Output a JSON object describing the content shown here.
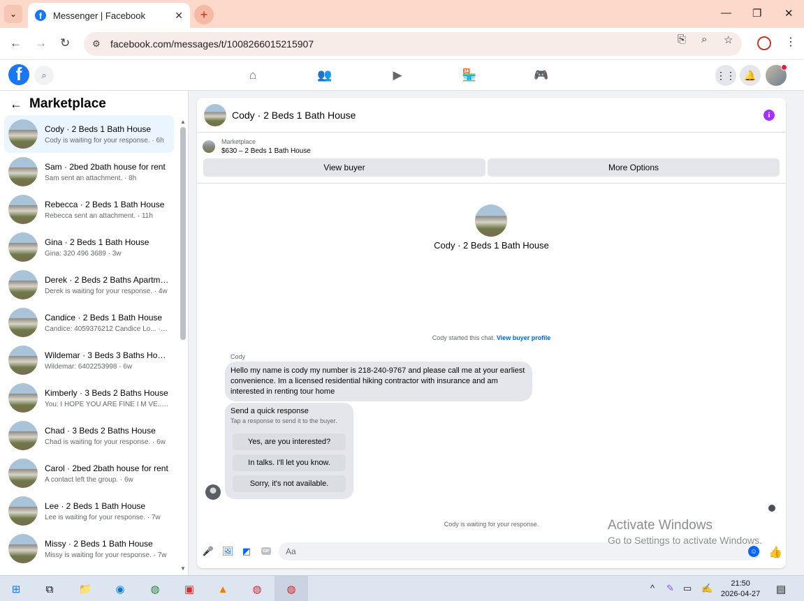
{
  "browser": {
    "tab_title": "Messenger | Facebook",
    "url": "facebook.com/messages/t/1008266015215907",
    "icons": [
      "tab-dropdown-icon",
      "facebook-favicon",
      "close-icon",
      "plus-icon",
      "minimize-icon",
      "restore-icon",
      "close-window-icon",
      "back-icon",
      "forward-icon",
      "reload-icon",
      "site-settings-icon",
      "install-app-icon",
      "zoom-icon",
      "star-icon",
      "profile-icon",
      "menu-icon"
    ]
  },
  "fb_header": {
    "logo": "f",
    "icons": [
      "search-icon",
      "home-icon",
      "friends-icon",
      "video-icon",
      "marketplace-icon",
      "gaming-icon",
      "menu-grid-icon",
      "notifications-icon",
      "account-avatar"
    ]
  },
  "sidebar": {
    "title": "Marketplace",
    "conversations": [
      {
        "name": "Cody · 2 Beds 1 Bath House",
        "sub": "Cody is waiting for your response. · 6h"
      },
      {
        "name": "Sam · 2bed 2bath house for rent",
        "sub": "Sam sent an attachment. · 8h"
      },
      {
        "name": "Rebecca · 2 Beds 1 Bath House",
        "sub": "Rebecca sent an attachment. · 11h"
      },
      {
        "name": "Gina · 2 Beds 1 Bath House",
        "sub": "Gina: 320 496 3689 · 3w"
      },
      {
        "name": "Derek · 2 Beds 2 Baths Apartme...",
        "sub": "Derek is waiting for your response. · 4w"
      },
      {
        "name": "Candice · 2 Beds 1 Bath House",
        "sub": "Candice: 4059376212 Candice Lo... · 4w"
      },
      {
        "name": "Wildemar · 3 Beds 3 Baths House",
        "sub": "Wildemar: 6402253998 · 6w"
      },
      {
        "name": "Kimberly · 3 Beds 2 Baths House",
        "sub": "You: I HOPE YOU ARE FINE I M VE... · 6w"
      },
      {
        "name": "Chad · 3 Beds 2 Baths House",
        "sub": "Chad is waiting for your response. · 6w"
      },
      {
        "name": "Carol · 2bed 2bath house for rent",
        "sub": "A contact left the group. · 6w"
      },
      {
        "name": "Lee · 2 Beds 1 Bath House",
        "sub": "Lee is waiting for your response. · 7w"
      },
      {
        "name": "Missy · 2 Beds 1 Bath House",
        "sub": "Missy is waiting for your response. · 7w"
      }
    ]
  },
  "chat": {
    "title": "Cody · 2 Beds 1 Bath House",
    "marketplace_label": "Marketplace",
    "listing": "$630 – 2 Beds 1 Bath House",
    "view_buyer": "View buyer",
    "more_options": "More Options",
    "center_name": "Cody · 2 Beds 1 Bath House",
    "started_text": "Cody started this chat.",
    "view_profile": "View buyer profile",
    "sender": "Cody",
    "message": "Hello my name is cody my number is 218-240-9767 and please call me at your earliest convenience. Im a licensed residential  hiking contractor with insurance and am interested in renting tour home",
    "quick_title": "Send a quick response",
    "quick_sub": "Tap a response to send it to the buyer.",
    "quick_replies": [
      "Yes, are you interested?",
      "In talks. I'll let you know.",
      "Sorry, it's not available."
    ],
    "waiting": "Cody is waiting for your response.",
    "composer_placeholder": "Aa",
    "gif_label": "GIF"
  },
  "watermark": {
    "line1": "Activate Windows",
    "line2": "Go to Settings to activate Windows."
  },
  "taskbar": {
    "time": "21:50",
    "date": "2026-04-27"
  }
}
